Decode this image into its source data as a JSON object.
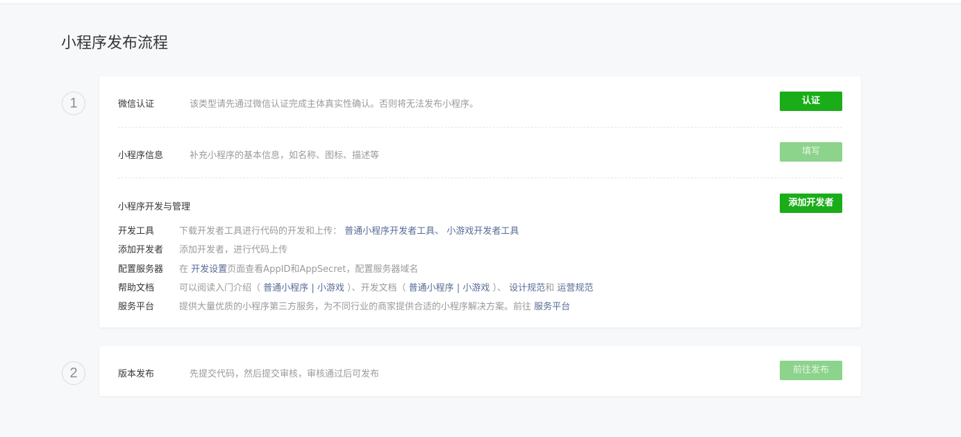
{
  "page": {
    "title": "小程序发布流程"
  },
  "step1": {
    "number": "1",
    "auth": {
      "label": "微信认证",
      "desc": "该类型请先通过微信认证完成主体真实性确认。否则将无法发布小程序。",
      "button": "认证"
    },
    "info": {
      "label": "小程序信息",
      "desc": "补充小程序的基本信息，如名称、图标、描述等",
      "button": "填写"
    },
    "dev": {
      "label": "小程序开发与管理",
      "button": "添加开发者",
      "tools": {
        "label": "开发工具",
        "desc": "下载开发者工具进行代码的开发和上传：",
        "link1": "普通小程序开发者工具",
        "sep": "、",
        "link2": "小游戏开发者工具"
      },
      "add_dev": {
        "label": "添加开发者",
        "desc": "添加开发者，进行代码上传"
      },
      "server": {
        "label": "配置服务器",
        "pre": "在",
        "link": "开发设置",
        "post": "页面查看AppID和AppSecret，配置服务器域名"
      },
      "help": {
        "label": "帮助文档",
        "t1": "可以阅读入门介绍（",
        "l1": "普通小程序",
        "t2": "|",
        "l2": "小游戏",
        "t3": "）、开发文档（",
        "l3": "普通小程序",
        "t4": "|",
        "l4": "小游戏",
        "t5": "）、",
        "l5": "设计规范",
        "t6": "和",
        "l6": "运营规范"
      },
      "platform": {
        "label": "服务平台",
        "desc": "提供大量优质的小程序第三方服务，为不同行业的商家提供合适的小程序解决方案。前往",
        "link": "服务平台"
      }
    }
  },
  "step2": {
    "number": "2",
    "label": "版本发布",
    "desc": "先提交代码，然后提交审核，审核通过后可发布",
    "button": "前往发布"
  },
  "colors": {
    "primary": "#1aad19",
    "disabled": "#8cd38b",
    "link": "#576b95"
  }
}
